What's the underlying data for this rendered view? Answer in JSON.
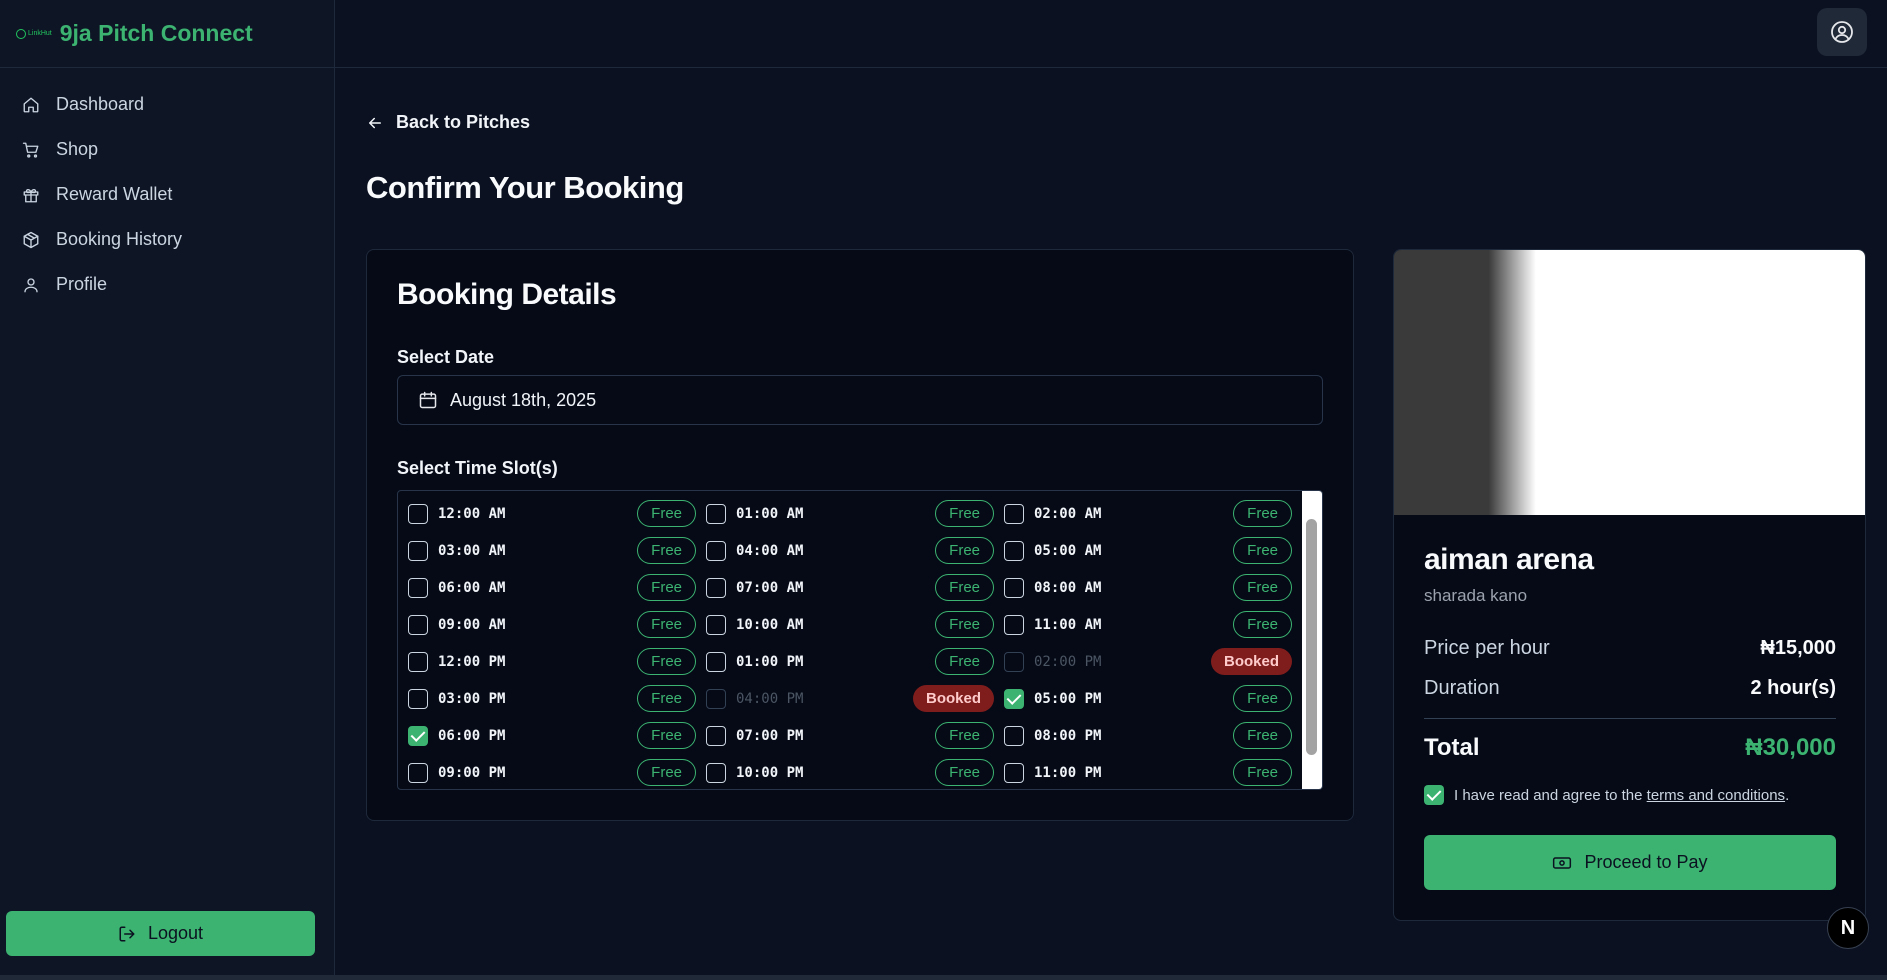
{
  "brand": {
    "logo_text": "LinkHut",
    "name": "9ja Pitch Connect"
  },
  "sidebar": {
    "items": [
      {
        "label": "Dashboard",
        "icon": "home-icon"
      },
      {
        "label": "Shop",
        "icon": "cart-icon"
      },
      {
        "label": "Reward Wallet",
        "icon": "gift-icon"
      },
      {
        "label": "Booking History",
        "icon": "package-icon"
      },
      {
        "label": "Profile",
        "icon": "user-icon"
      }
    ],
    "logout_label": "Logout"
  },
  "main": {
    "back_label": "Back to Pitches",
    "page_title": "Confirm Your Booking",
    "details": {
      "title": "Booking Details",
      "date_label": "Select Date",
      "date_value": "August 18th, 2025",
      "slots_label": "Select Time Slot(s)",
      "slots": [
        {
          "time": "12:00 AM",
          "status": "Free",
          "checked": false
        },
        {
          "time": "01:00 AM",
          "status": "Free",
          "checked": false
        },
        {
          "time": "02:00 AM",
          "status": "Free",
          "checked": false
        },
        {
          "time": "03:00 AM",
          "status": "Free",
          "checked": false
        },
        {
          "time": "04:00 AM",
          "status": "Free",
          "checked": false
        },
        {
          "time": "05:00 AM",
          "status": "Free",
          "checked": false
        },
        {
          "time": "06:00 AM",
          "status": "Free",
          "checked": false
        },
        {
          "time": "07:00 AM",
          "status": "Free",
          "checked": false
        },
        {
          "time": "08:00 AM",
          "status": "Free",
          "checked": false
        },
        {
          "time": "09:00 AM",
          "status": "Free",
          "checked": false
        },
        {
          "time": "10:00 AM",
          "status": "Free",
          "checked": false
        },
        {
          "time": "11:00 AM",
          "status": "Free",
          "checked": false
        },
        {
          "time": "12:00 PM",
          "status": "Free",
          "checked": false
        },
        {
          "time": "01:00 PM",
          "status": "Free",
          "checked": false
        },
        {
          "time": "02:00 PM",
          "status": "Booked",
          "checked": false
        },
        {
          "time": "03:00 PM",
          "status": "Free",
          "checked": false
        },
        {
          "time": "04:00 PM",
          "status": "Booked",
          "checked": false
        },
        {
          "time": "05:00 PM",
          "status": "Free",
          "checked": true
        },
        {
          "time": "06:00 PM",
          "status": "Free",
          "checked": true
        },
        {
          "time": "07:00 PM",
          "status": "Free",
          "checked": false
        },
        {
          "time": "08:00 PM",
          "status": "Free",
          "checked": false
        },
        {
          "time": "09:00 PM",
          "status": "Free",
          "checked": false
        },
        {
          "time": "10:00 PM",
          "status": "Free",
          "checked": false
        },
        {
          "time": "11:00 PM",
          "status": "Free",
          "checked": false
        }
      ]
    },
    "summary": {
      "pitch_name": "aiman arena",
      "location": "sharada kano",
      "price_label": "Price per hour",
      "price_value": "₦15,000",
      "duration_label": "Duration",
      "duration_value": "2 hour(s)",
      "total_label": "Total",
      "total_value": "₦30,000",
      "terms_prefix": "I have read and agree to the ",
      "terms_link": "terms and conditions",
      "terms_suffix": ".",
      "terms_checked": true,
      "pay_label": "Proceed to Pay"
    }
  },
  "floating_badge": "N",
  "colors": {
    "accent": "#3cb371",
    "booked": "#7f1d1d",
    "background": "#0b1120"
  }
}
